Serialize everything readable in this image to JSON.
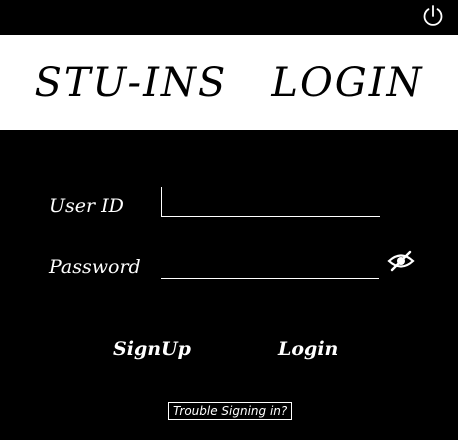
{
  "header": {
    "title": "STU-INS   LOGIN",
    "power_icon": "power-icon"
  },
  "form": {
    "userid_label": "User ID",
    "userid_value": "",
    "password_label": "Password",
    "password_value": "",
    "visibility_icon": "eye-slash-icon"
  },
  "actions": {
    "signup_label": "SignUp",
    "login_label": "Login",
    "trouble_label": "Trouble Signing in?"
  },
  "colors": {
    "background": "#000000",
    "banner": "#ffffff",
    "text": "#ffffff"
  }
}
